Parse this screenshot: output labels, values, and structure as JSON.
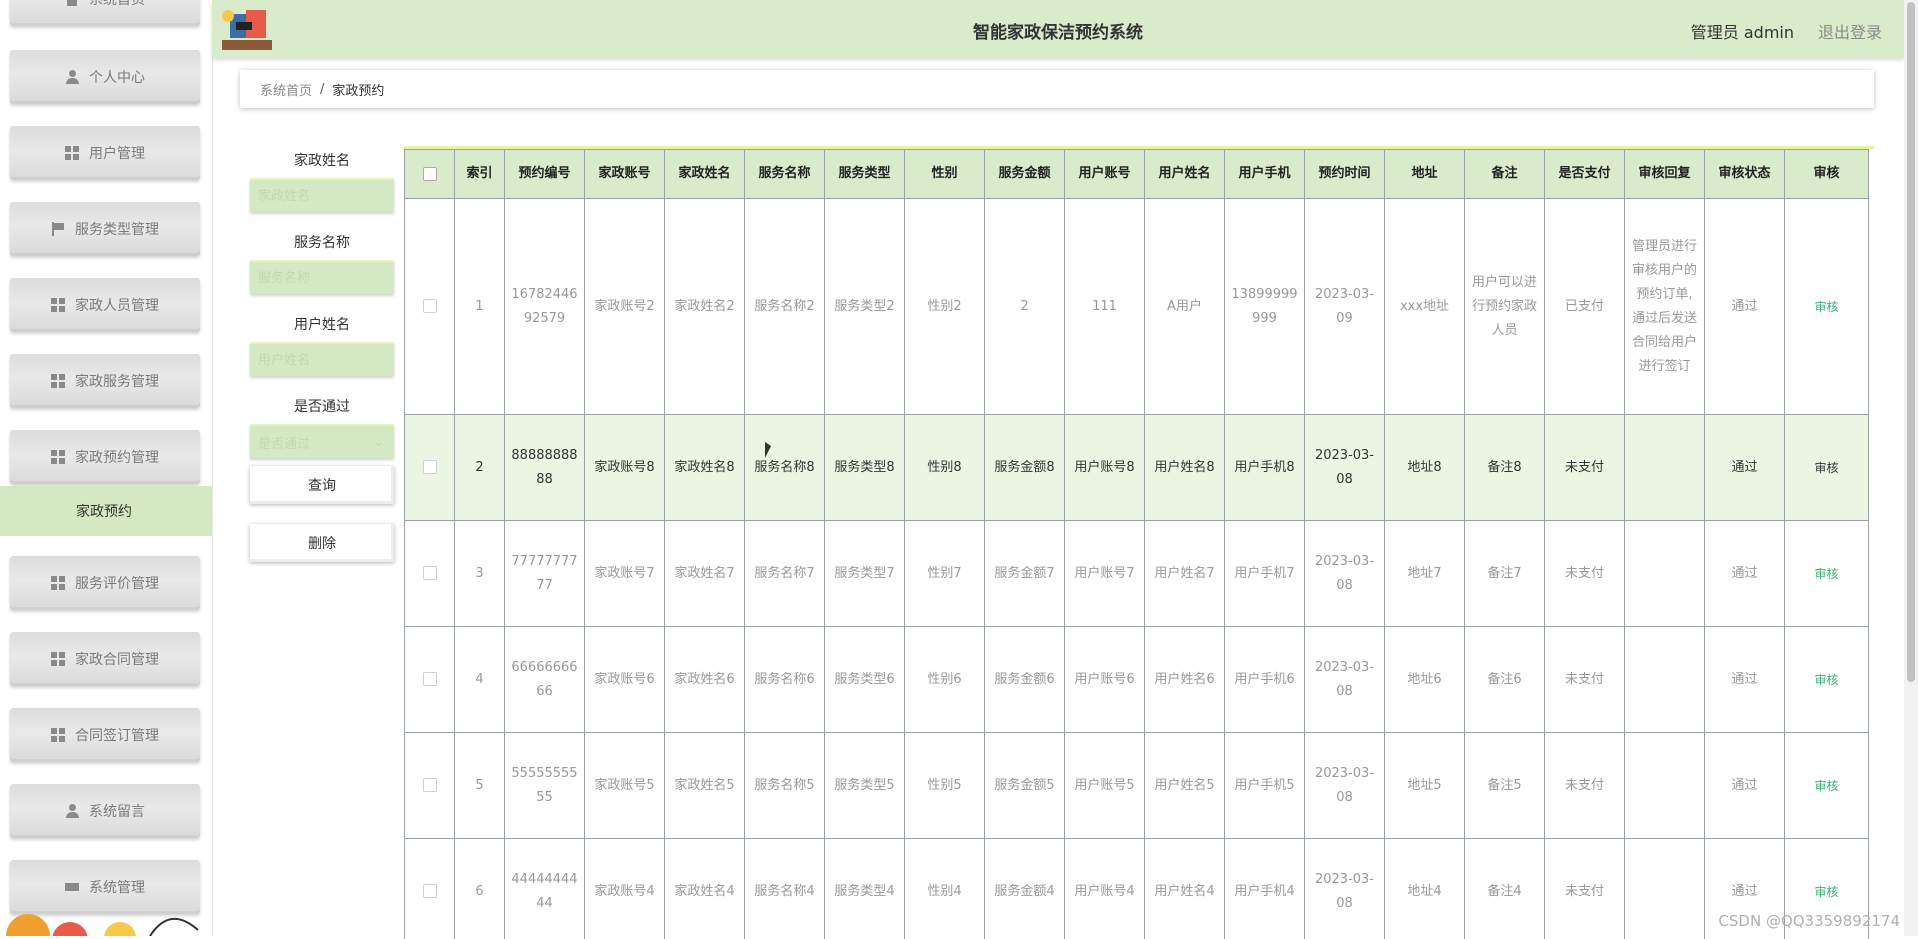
{
  "header": {
    "title": "智能家政保洁预约系统",
    "admin": "管理员 admin",
    "logout": "退出登录"
  },
  "sidebar": {
    "items": [
      {
        "label": "系统首页",
        "icon": "home-icon"
      },
      {
        "label": "个人中心",
        "icon": "user-icon"
      },
      {
        "label": "用户管理",
        "icon": "grid-icon"
      },
      {
        "label": "服务类型管理",
        "icon": "flag-icon"
      },
      {
        "label": "家政人员管理",
        "icon": "grid-icon"
      },
      {
        "label": "家政服务管理",
        "icon": "grid-icon"
      },
      {
        "label": "家政预约管理",
        "icon": "grid-icon"
      },
      {
        "label": "服务评价管理",
        "icon": "grid-icon"
      },
      {
        "label": "家政合同管理",
        "icon": "grid-icon"
      },
      {
        "label": "合同签订管理",
        "icon": "grid-icon"
      },
      {
        "label": "系统留言",
        "icon": "user-icon"
      },
      {
        "label": "系统管理",
        "icon": "ticket-icon"
      }
    ],
    "active_sub": "家政预约"
  },
  "breadcrumb": {
    "home": "系统首页",
    "sep": "/",
    "current": "家政预约"
  },
  "search": {
    "f1_label": "家政姓名",
    "f1_ph": "家政姓名",
    "f2_label": "服务名称",
    "f2_ph": "服务名称",
    "f3_label": "用户姓名",
    "f3_ph": "用户姓名",
    "f4_label": "是否通过",
    "f4_ph": "是否通过",
    "query_btn": "查询",
    "delete_btn": "删除"
  },
  "table": {
    "columns": [
      "索引",
      "预约编号",
      "家政账号",
      "家政姓名",
      "服务名称",
      "服务类型",
      "性别",
      "服务金额",
      "用户账号",
      "用户姓名",
      "用户手机",
      "预约时间",
      "地址",
      "备注",
      "是否支付",
      "审核回复",
      "审核状态",
      "审核"
    ],
    "rows": [
      [
        "1",
        "1678244692579",
        "家政账号2",
        "家政姓名2",
        "服务名称2",
        "服务类型2",
        "性别2",
        "2",
        "111",
        "A用户",
        "13899999999",
        "2023-03-09",
        "xxx地址",
        "用户可以进行预约家政人员",
        "已支付",
        "管理员进行审核用户的预约订单, 通过后发送合同给用户进行签订",
        "通过",
        "审核"
      ],
      [
        "2",
        "8888888888",
        "家政账号8",
        "家政姓名8",
        "服务名称8",
        "服务类型8",
        "性别8",
        "服务金额8",
        "用户账号8",
        "用户姓名8",
        "用户手机8",
        "2023-03-08",
        "地址8",
        "备注8",
        "未支付",
        "",
        "通过",
        "审核"
      ],
      [
        "3",
        "7777777777",
        "家政账号7",
        "家政姓名7",
        "服务名称7",
        "服务类型7",
        "性别7",
        "服务金额7",
        "用户账号7",
        "用户姓名7",
        "用户手机7",
        "2023-03-08",
        "地址7",
        "备注7",
        "未支付",
        "",
        "通过",
        "审核"
      ],
      [
        "4",
        "6666666666",
        "家政账号6",
        "家政姓名6",
        "服务名称6",
        "服务类型6",
        "性别6",
        "服务金额6",
        "用户账号6",
        "用户姓名6",
        "用户手机6",
        "2023-03-08",
        "地址6",
        "备注6",
        "未支付",
        "",
        "通过",
        "审核"
      ],
      [
        "5",
        "5555555555",
        "家政账号5",
        "家政姓名5",
        "服务名称5",
        "服务类型5",
        "性别5",
        "服务金额5",
        "用户账号5",
        "用户姓名5",
        "用户手机5",
        "2023-03-08",
        "地址5",
        "备注5",
        "未支付",
        "",
        "通过",
        "审核"
      ],
      [
        "6",
        "4444444444",
        "家政账号4",
        "家政姓名4",
        "服务名称4",
        "服务类型4",
        "性别4",
        "服务金额4",
        "用户账号4",
        "用户姓名4",
        "用户手机4",
        "2023-03-08",
        "地址4",
        "备注4",
        "未支付",
        "",
        "通过",
        "审核"
      ]
    ],
    "highlight_row": 1
  },
  "watermark": "CSDN @QQ3359892174",
  "colors": {
    "accent": "#d9ebcb",
    "link": "#3fae7a",
    "highlight": "#ebf5e1"
  }
}
